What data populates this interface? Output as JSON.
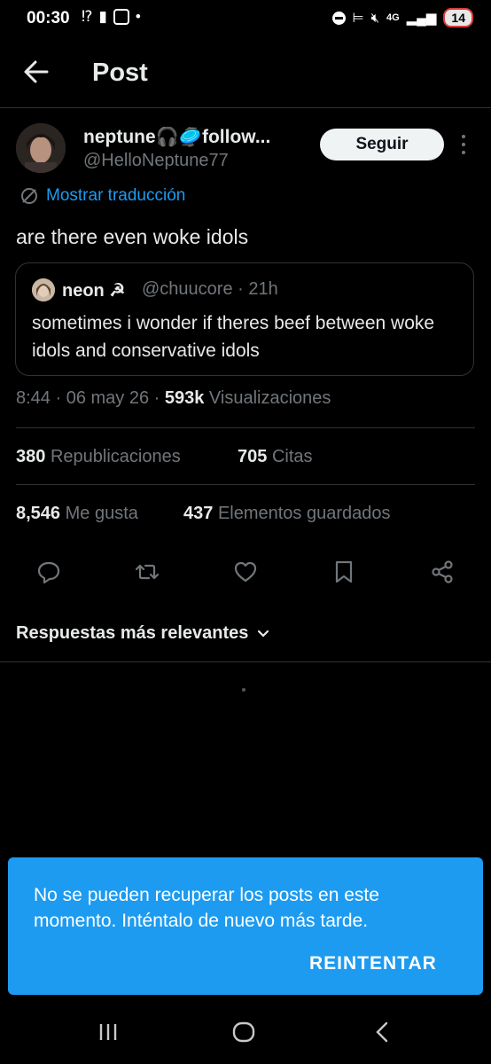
{
  "status_bar": {
    "time": "00:30",
    "network": "4G",
    "battery": "14",
    "left_icons": [
      "notification-icon",
      "lock-icon",
      "instagram-icon",
      "dot-icon"
    ],
    "right_icons": [
      "dnd-icon",
      "sleep-icon",
      "mute-icon",
      "data-icon",
      "signal-icon"
    ]
  },
  "header": {
    "title": "Post"
  },
  "author": {
    "name": "neptune🎧🥏follow...",
    "handle": "@HelloNeptune77",
    "follow_label": "Seguir"
  },
  "translate_label": "Mostrar traducción",
  "post": {
    "text": "are there even woke idols"
  },
  "quote": {
    "name": "neon ☭",
    "handle_time": "@chuucore · 21h",
    "text": "sometimes i wonder if theres beef between woke idols and conservative idols"
  },
  "meta": {
    "time_date": "8:44 · 06 may 26 · ",
    "views_count": "593k",
    "views_label": " Visualizaciones"
  },
  "stats": {
    "reposts_count": "380",
    "reposts_label": "Republicaciones",
    "quotes_count": "705",
    "quotes_label": "Citas",
    "likes_count": "8,546",
    "likes_label": "Me gusta",
    "bookmarks_count": "437",
    "bookmarks_label": "Elementos guardados"
  },
  "actions": [
    "reply-icon",
    "repost-icon",
    "like-icon",
    "bookmark-icon",
    "share-icon"
  ],
  "replies_sort": {
    "label": "Respuestas más relevantes"
  },
  "toast": {
    "message": "No se pueden recuperar los posts en este momento. Inténtalo de nuevo más tarde.",
    "action_label": "REINTENTAR"
  },
  "colors": {
    "background": "#000000",
    "accent": "#1d9bf0",
    "text_primary": "#e7e9ea",
    "text_secondary": "#71767b",
    "border": "#2f3336"
  }
}
